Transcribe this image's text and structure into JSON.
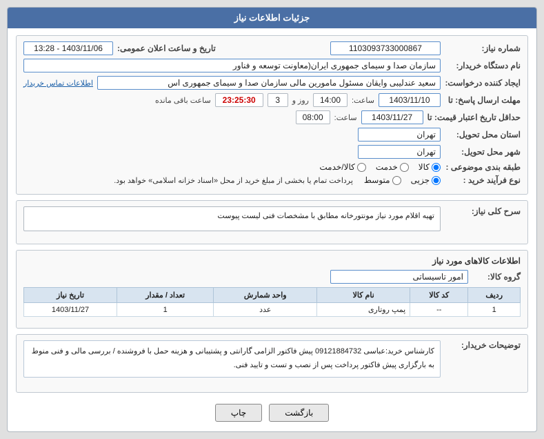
{
  "header": {
    "title": "جزئیات اطلاعات نیاز"
  },
  "fields": {
    "shomare_niaz_label": "شماره نیاز:",
    "shomare_niaz_value": "1103093733000867",
    "nam_dastgah_label": "نام دستگاه خریدار:",
    "nam_dastgah_value": "سازمان صدا و سیمای جمهوری ایران(معاونت توسعه و فناور",
    "ijad_konande_label": "ایجاد کننده درخواست:",
    "ijad_konande_value": "سعید عندلیبی وایقان مسئول مامورین مالی  سازمان صدا و سیمای جمهوری اس",
    "tarikh_label": "تاریخ و ساعت اعلان عمومی:",
    "tarikh_value": "1403/11/06 - 13:28",
    "mohlat_ersal_label": "مهلت ارسال پاسخ: تا",
    "mohlat_date": "1403/11/10",
    "mohlat_saat_label": "ساعت:",
    "mohlat_saat": "14:00",
    "mohlat_rooz_label": "روز و",
    "mohlat_rooz": "3",
    "mohlat_mande_label": "ساعت باقی مانده",
    "mohlat_countdown": "23:25:30",
    "hadaqal_label": "حداقل تاریخ اعتبار قیمت: تا",
    "hadaqal_date": "1403/11/27",
    "hadaqal_saat_label": "ساعت:",
    "hadaqal_saat": "08:00",
    "ostan_label": "استان محل تحویل:",
    "ostan_value": "تهران",
    "shahr_label": "شهر محل تحویل:",
    "shahr_value": "تهران",
    "tabaqe_label": "طبقه بندی موضوعی :",
    "tabaqe_options": [
      "کالا",
      "خدمت",
      "کالا/خدمت"
    ],
    "tabaqe_selected": "کالا",
    "nav_farayand_label": "نوع فرآیند خرید :",
    "nav_options": [
      "جزیی",
      "متوسط",
      ""
    ],
    "nav_selected": "جزیی",
    "nav_note": "پرداخت تمام یا بخشی از مبلغ خرید از محل «اسناد خزانه اسلامی» خواهد بود.",
    "sharh_label": "سرح کلی نیاز:",
    "sharh_value": "تهیه اقلام مورد نیاز مونتورخانه مطابق با مشخصات فنی لیست پیوست",
    "kala_info_label": "اطلاعات کالاهای مورد نیاز",
    "goroh_label": "گروه کالا:",
    "goroh_value": "امور تاسیساتی",
    "tamas_label": "اطلاعات تماس خریدار"
  },
  "table": {
    "headers": [
      "ردیف",
      "کد کالا",
      "نام کالا",
      "واحد شمارش",
      "تعداد / مقدار",
      "تاریخ نیاز"
    ],
    "rows": [
      {
        "radif": "1",
        "kod": "--",
        "name": "پمپ روتاری",
        "vahed": "عدد",
        "tedad": "1",
        "tarikh": "1403/11/27"
      }
    ]
  },
  "description": {
    "label": "توضیحات خریدار:",
    "value": "کارشناس خرید:عباسی 09121884732  پیش فاکتور الزامی\nگارانتی و پشتیبانی و هزینه حمل با فروشنده / بررسی مالی و فنی منوط به بارگزاری پیش فاکتور\nپرداخت پس از نصب و تست و تایید فنی."
  },
  "buttons": {
    "print": "چاپ",
    "back": "بازگشت"
  }
}
